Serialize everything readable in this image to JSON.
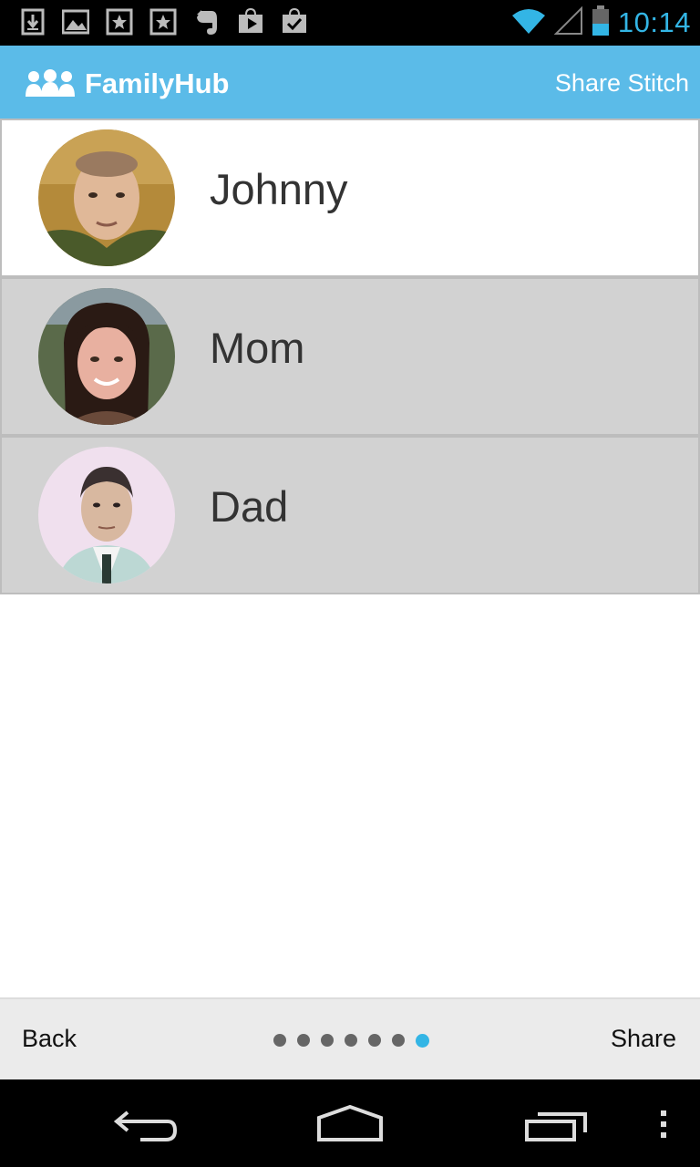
{
  "status_bar": {
    "time": "10:14",
    "time_color": "#33b5e5",
    "notification_icons": [
      "download-icon",
      "image-icon",
      "star-box-icon",
      "star-box-icon",
      "evernote-icon",
      "play-store-icon",
      "shopping-bag-icon"
    ],
    "right_icons": [
      "wifi-icon",
      "cell-signal-icon",
      "battery-icon"
    ]
  },
  "action_bar": {
    "app_title": "FamilyHub",
    "action_label": "Share Stitch",
    "background": "#5bbbe8"
  },
  "members": [
    {
      "name": "Johnny",
      "selected": true
    },
    {
      "name": "Mom",
      "selected": false
    },
    {
      "name": "Dad",
      "selected": false
    }
  ],
  "bottom_bar": {
    "back_label": "Back",
    "share_label": "Share",
    "page_count": 7,
    "current_page": 7
  },
  "colors": {
    "accent": "#33b5e5",
    "selected_row": "#ffffff",
    "unselected_row": "#d2d2d2"
  }
}
